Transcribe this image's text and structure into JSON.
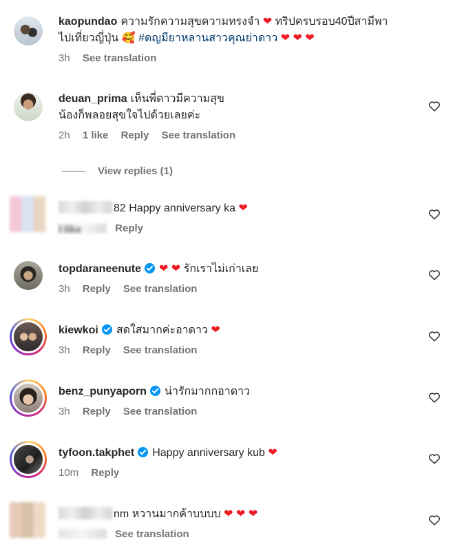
{
  "comments": [
    {
      "username": "kaopundao",
      "text": "ความรักความสุขความทรงจำ",
      "text2": "ทริปครบรอบ40ปีสามีพา",
      "text3": "ไปเที่ยวญี่ปุ่น",
      "hashtag": "#ดญมียาหลานสาวคุณย่าดาว",
      "time": "3h",
      "see_translation": "See translation"
    },
    {
      "username": "deuan_prima",
      "text": "เห็นพี่ดาวมีความสุข",
      "text2": "น้องก็พลอยสุขใจไปด้วยเลยค่ะ",
      "time": "2h",
      "likes": "1 like",
      "reply": "Reply",
      "see_translation": "See translation"
    },
    {
      "username": "",
      "text": "82 Happy anniversary ka",
      "likes": "l like",
      "reply": "Reply"
    },
    {
      "username": "topdaraneenute",
      "text": "รักเราไม่เก่าเลย",
      "time": "3h",
      "reply": "Reply",
      "see_translation": "See translation"
    },
    {
      "username": "kiewkoi",
      "text": "สดใสมากค่ะอาดาว",
      "time": "3h",
      "reply": "Reply",
      "see_translation": "See translation"
    },
    {
      "username": "benz_punyaporn",
      "text": "น่ารักมากกอาดาว",
      "time": "3h",
      "reply": "Reply",
      "see_translation": "See translation"
    },
    {
      "username": "tyfoon.takphet",
      "text": "Happy anniversary kub",
      "time": "10m",
      "reply": "Reply"
    },
    {
      "username": "nm",
      "text": "หวานมากค้าบบบบ",
      "see_translation": "See translation"
    }
  ],
  "view_replies": "View replies (1)",
  "icons": {
    "heart": "heart-outline-icon",
    "verified": "verified-badge-icon"
  },
  "colors": {
    "heart_red": "#ed1c24",
    "verified_blue": "#0095f6",
    "hashtag": "#00376b",
    "meta_gray": "#737373"
  }
}
